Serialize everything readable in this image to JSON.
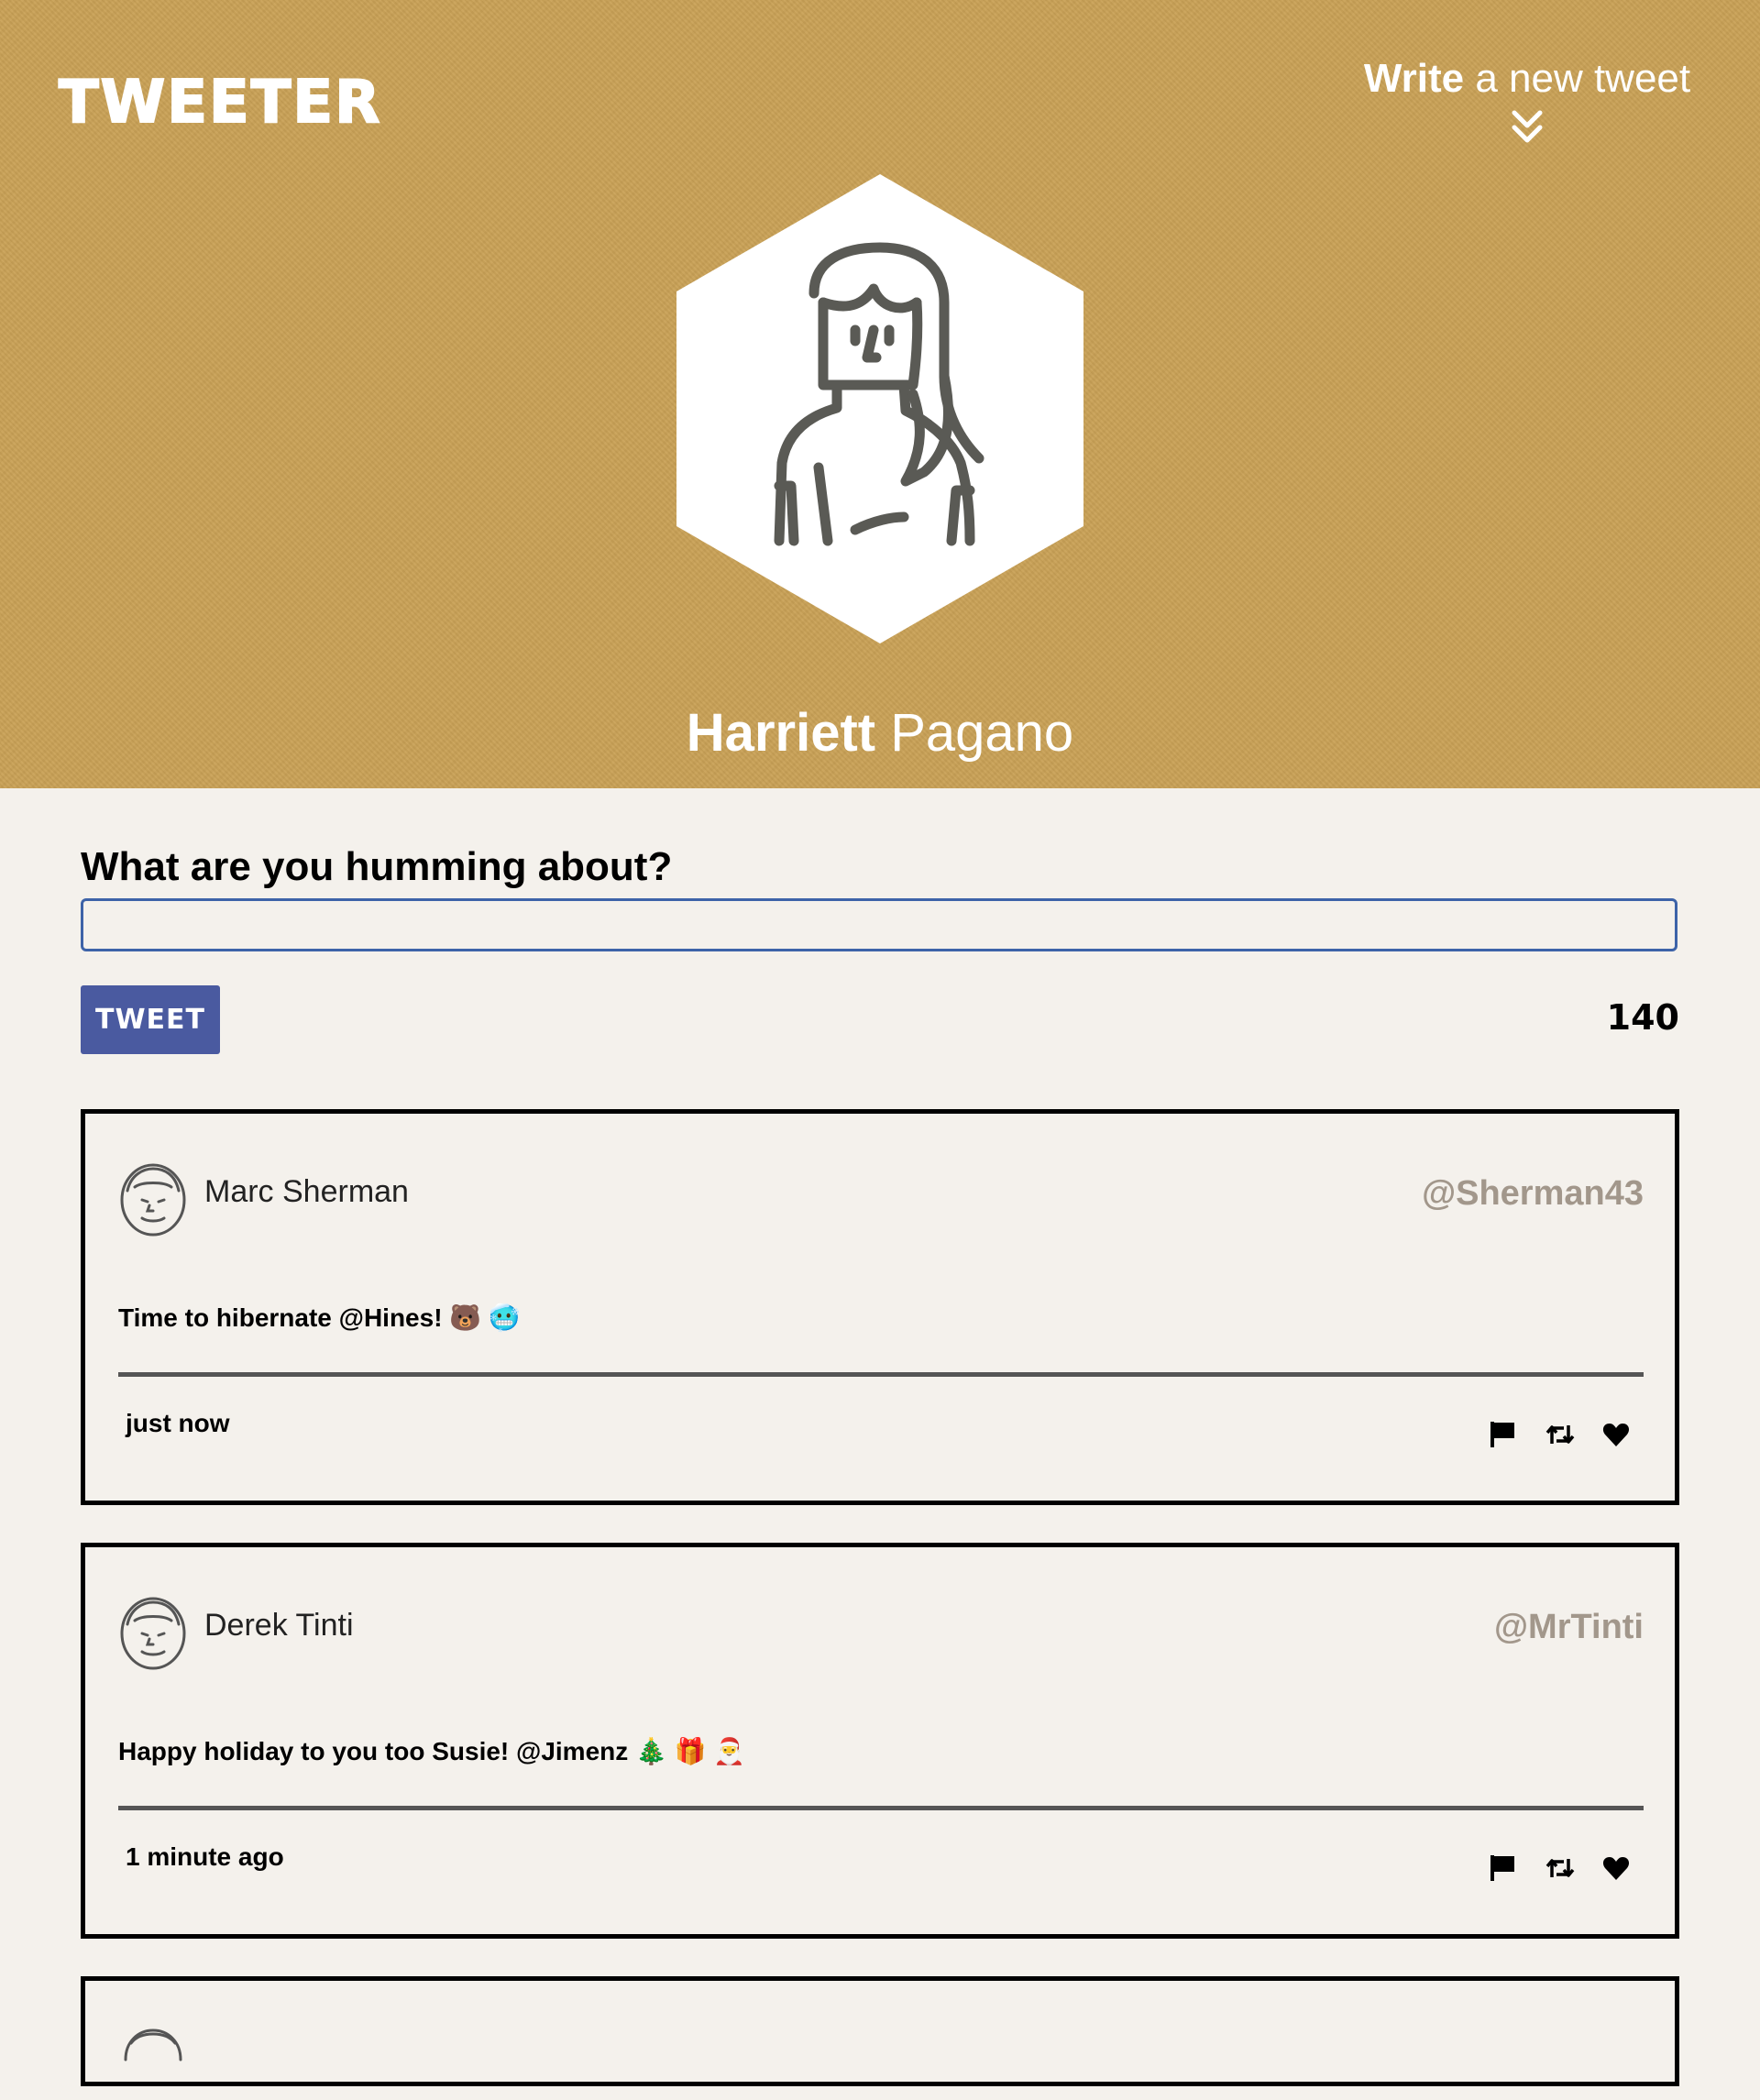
{
  "app": {
    "logo": "TWEETER"
  },
  "header": {
    "compose_toggle": {
      "strong": "Write",
      "rest": " a new tweet"
    },
    "profile": {
      "first_name": "Harriett",
      "last_name": " Pagano"
    }
  },
  "compose": {
    "label": "What are you humming about?",
    "value": "",
    "placeholder": "",
    "button_label": "TWEET",
    "char_count": "140"
  },
  "tweets": [
    {
      "name": "Marc Sherman",
      "handle": "@Sherman43",
      "text": "Time to hibernate @Hines! 🐻 🥶",
      "time": "just now"
    },
    {
      "name": "Derek Tinti",
      "handle": "@MrTinti",
      "text": "Happy holiday to you too Susie! @Jimenz 🎄 🎁 🎅",
      "time": "1 minute ago"
    }
  ],
  "colors": {
    "header_bg": "#c9a156",
    "accent_button": "#4a5aa0",
    "input_border": "#3d63a8",
    "handle": "#a2978b"
  },
  "icons": [
    "flag-icon",
    "retweet-icon",
    "heart-icon",
    "chevron-double-down-icon"
  ]
}
